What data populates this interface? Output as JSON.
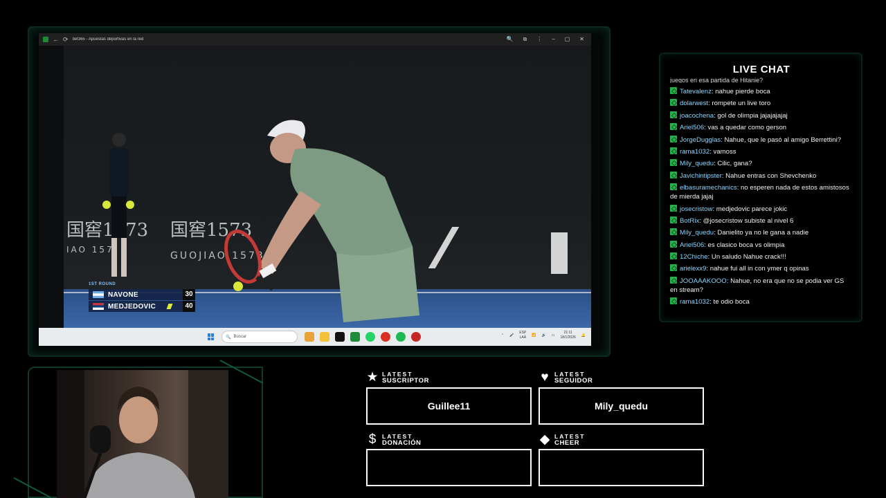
{
  "browser": {
    "title": "bet365 - Apuestas deportivas en la red",
    "nav_back": "←",
    "nav_reload": "⟳",
    "controls": [
      "🔍",
      "⧉",
      "⋮",
      "–",
      "▢",
      "✕"
    ]
  },
  "video": {
    "ad_text_1": "国窖1573",
    "ad_text_2": "国窖1573",
    "ad_sub_1": "GUOJIAO 1573",
    "ad_sub_2": "IAO 157",
    "scoreboard": {
      "round": "1ST ROUND",
      "players": [
        {
          "name": "NAVONE",
          "score": "30",
          "serving": false
        },
        {
          "name": "MEDJEDOVIC",
          "score": "40",
          "serving": true
        }
      ]
    }
  },
  "taskbar": {
    "search_placeholder": "Buscar",
    "lang_top": "ESP",
    "lang_bottom": "LAA",
    "time": "21:11",
    "date": "18/1/2026"
  },
  "chat": {
    "title": "LIVE CHAT",
    "partial_line": "juegos en esa partida de Hitanie?",
    "messages": [
      {
        "user": "Tatevalenz",
        "text": "nahue pierde boca"
      },
      {
        "user": "dolarwest",
        "text": "rompete un live toro"
      },
      {
        "user": "joacochena",
        "text": "gol de olimpia jajajajajaj"
      },
      {
        "user": "Ariel506",
        "text": "vas a quedar como gerson"
      },
      {
        "user": "JorgeDugglas",
        "text": "Nahue, que le pasó al amigo Berrettini?"
      },
      {
        "user": "rama1032",
        "text": "vamoss"
      },
      {
        "user": "Mily_quedu",
        "text": "Cilic, gana?"
      },
      {
        "user": "Javichintipster",
        "text": "Nahue entras con Shevchenko"
      },
      {
        "user": "elbasuramechanics",
        "text": "no esperen nada de estos amistosos de mierda jajaj"
      },
      {
        "user": "josecristow",
        "text": "medjedovic parece jokic"
      },
      {
        "user": "BotRix",
        "text": "@josecristow subiste al nivel 6"
      },
      {
        "user": "Mily_quedu",
        "text": "Danielito ya no le gana a nadie"
      },
      {
        "user": "Ariel506",
        "text": "es clasico boca vs olimpia"
      },
      {
        "user": "12Chiche",
        "text": "Un saludo Nahue crack!!!"
      },
      {
        "user": "arielexx9",
        "text": "nahue fui all in con ymer q opinas"
      },
      {
        "user": "JOOAAAKOOO",
        "text": "Nahue, no era que no se podia ver GS en stream?"
      },
      {
        "user": "rama1032",
        "text": "te odio boca"
      }
    ]
  },
  "alerts": {
    "suscriptor": {
      "top": "LATEST",
      "bottom": "SUSCRIPTOR",
      "icon": "★",
      "value": "Guillee11"
    },
    "seguidor": {
      "top": "LATEST",
      "bottom": "SEGUIDOR",
      "icon": "♥",
      "value": "Mily_quedu"
    },
    "donacion": {
      "top": "LATEST",
      "bottom": "DONACIÓN",
      "icon": "$",
      "value": ""
    },
    "cheer": {
      "top": "LATEST",
      "bottom": "CHEER",
      "icon": "◆",
      "value": ""
    }
  },
  "colors": {
    "accent_green": "#0e5a44",
    "chat_username": "#8ad4ff",
    "badge_green": "#27b14a",
    "scoreboard_bg": "#142446"
  }
}
